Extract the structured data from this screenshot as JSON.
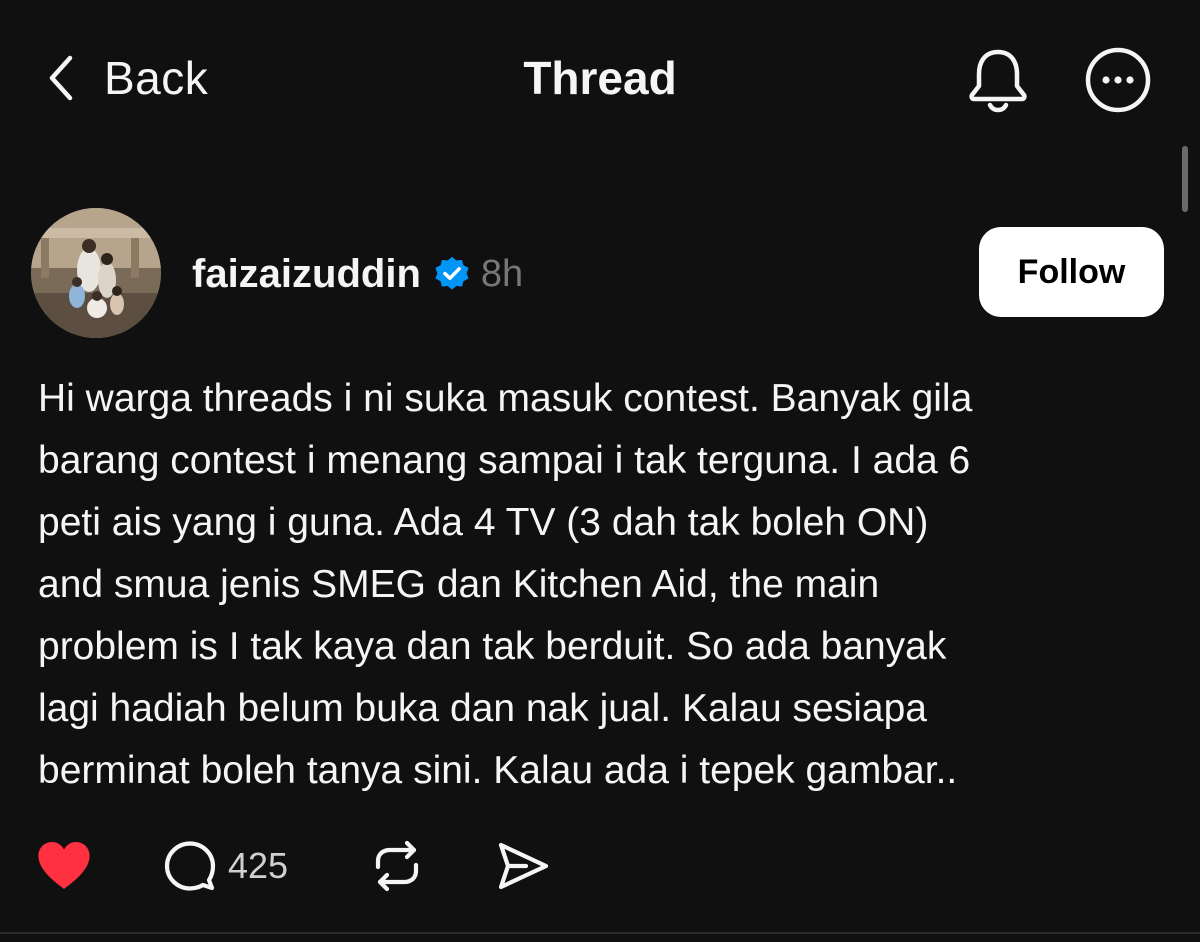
{
  "header": {
    "back_label": "Back",
    "title": "Thread",
    "icons": [
      "chevron-left-icon",
      "bell-icon",
      "more-options-icon"
    ]
  },
  "post": {
    "username": "faizaizuddin",
    "verified": true,
    "time_ago": "8h",
    "follow_label": "Follow",
    "body_lines": [
      "Hi warga threads i ni suka masuk contest. Banyak gila",
      "barang contest i menang sampai i tak terguna. I ada 6",
      "peti ais yang i guna. Ada 4 TV (3 dah tak boleh ON)",
      "and smua jenis SMEG dan Kitchen Aid, the main",
      "problem is I tak kaya dan tak berduit. So ada banyak",
      "lagi hadiah belum buka dan nak jual. Kalau sesiapa",
      "berminat boleh tanya sini. Kalau ada i tepek gambar.."
    ],
    "liked": true,
    "comment_count": "425"
  },
  "colors": {
    "background": "#101010",
    "text_primary": "#f3f5f7",
    "text_secondary": "#777777",
    "like_red": "#ff3040",
    "verified_blue": "#0095f6",
    "follow_button_bg": "#ffffff"
  }
}
